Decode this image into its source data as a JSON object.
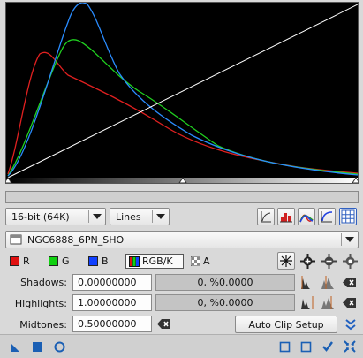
{
  "histogram": {
    "channel_colors": {
      "red": "#e02020",
      "green": "#20d020",
      "blue": "#2a8cff",
      "curve": "#ffffff"
    }
  },
  "toolbar": {
    "bit_depth": "16-bit (64K)",
    "graph_style": "Lines",
    "icons": [
      "log-scale-icon",
      "histogram-icon",
      "rgb-histogram-icon",
      "curve-icon",
      "grid-icon"
    ]
  },
  "image_selector": {
    "value": "NGC6888_6PN_SHO"
  },
  "channels": {
    "r": "R",
    "g": "G",
    "b": "B",
    "rgbk": "RGB/K",
    "a": "A",
    "colors": {
      "r": "#e01010",
      "g": "#10d010",
      "b": "#1040ff"
    }
  },
  "shadows": {
    "label": "Shadows:",
    "value": "0.00000000",
    "clip": "0, %0.0000"
  },
  "highlights": {
    "label": "Highlights:",
    "value": "1.00000000",
    "clip": "0, %0.0000"
  },
  "midtones": {
    "label": "Midtones:",
    "value": "0.50000000"
  },
  "auto_clip": {
    "label": "Auto Clip Setup"
  }
}
